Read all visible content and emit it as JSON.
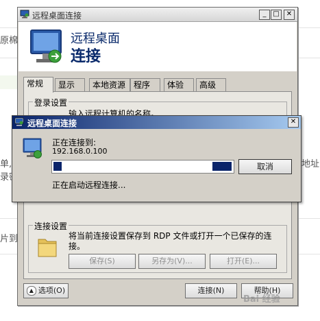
{
  "background": {
    "frag_top": "原棉",
    "frag_left1": "单,",
    "frag_left2": "录密",
    "frag_left3": "片到",
    "frag_right": "地址"
  },
  "main_window": {
    "title": "远程桌面连接",
    "min_label": "_",
    "max_label": "□",
    "close_label": "✕",
    "heading1": "远程桌面",
    "heading2": "连接",
    "tabs": [
      "常规",
      "显示",
      "本地资源",
      "程序",
      "体验",
      "高级"
    ],
    "login_group_label": "登录设置",
    "login_hint": "输入远程计算机的名称。",
    "connect_group_label": "连接设置",
    "connect_text_line1": "将当前连接设置保存到 RDP 文件或打开一个已保存的连",
    "connect_text_line2": "接。",
    "save_button": "保存(S)",
    "save_as_button": "另存为(V)...",
    "open_button": "打开(E)...",
    "options_button": "选项(O)",
    "connect_button": "连接(N)",
    "help_button": "帮助(H)"
  },
  "dialog": {
    "title": "远程桌面连接",
    "close_label": "✕",
    "connecting_label": "正在连接到:",
    "address": "192.168.0.100",
    "cancel_button": "取消",
    "status": "正在启动远程连接..."
  },
  "watermark": "Bai 经验"
}
